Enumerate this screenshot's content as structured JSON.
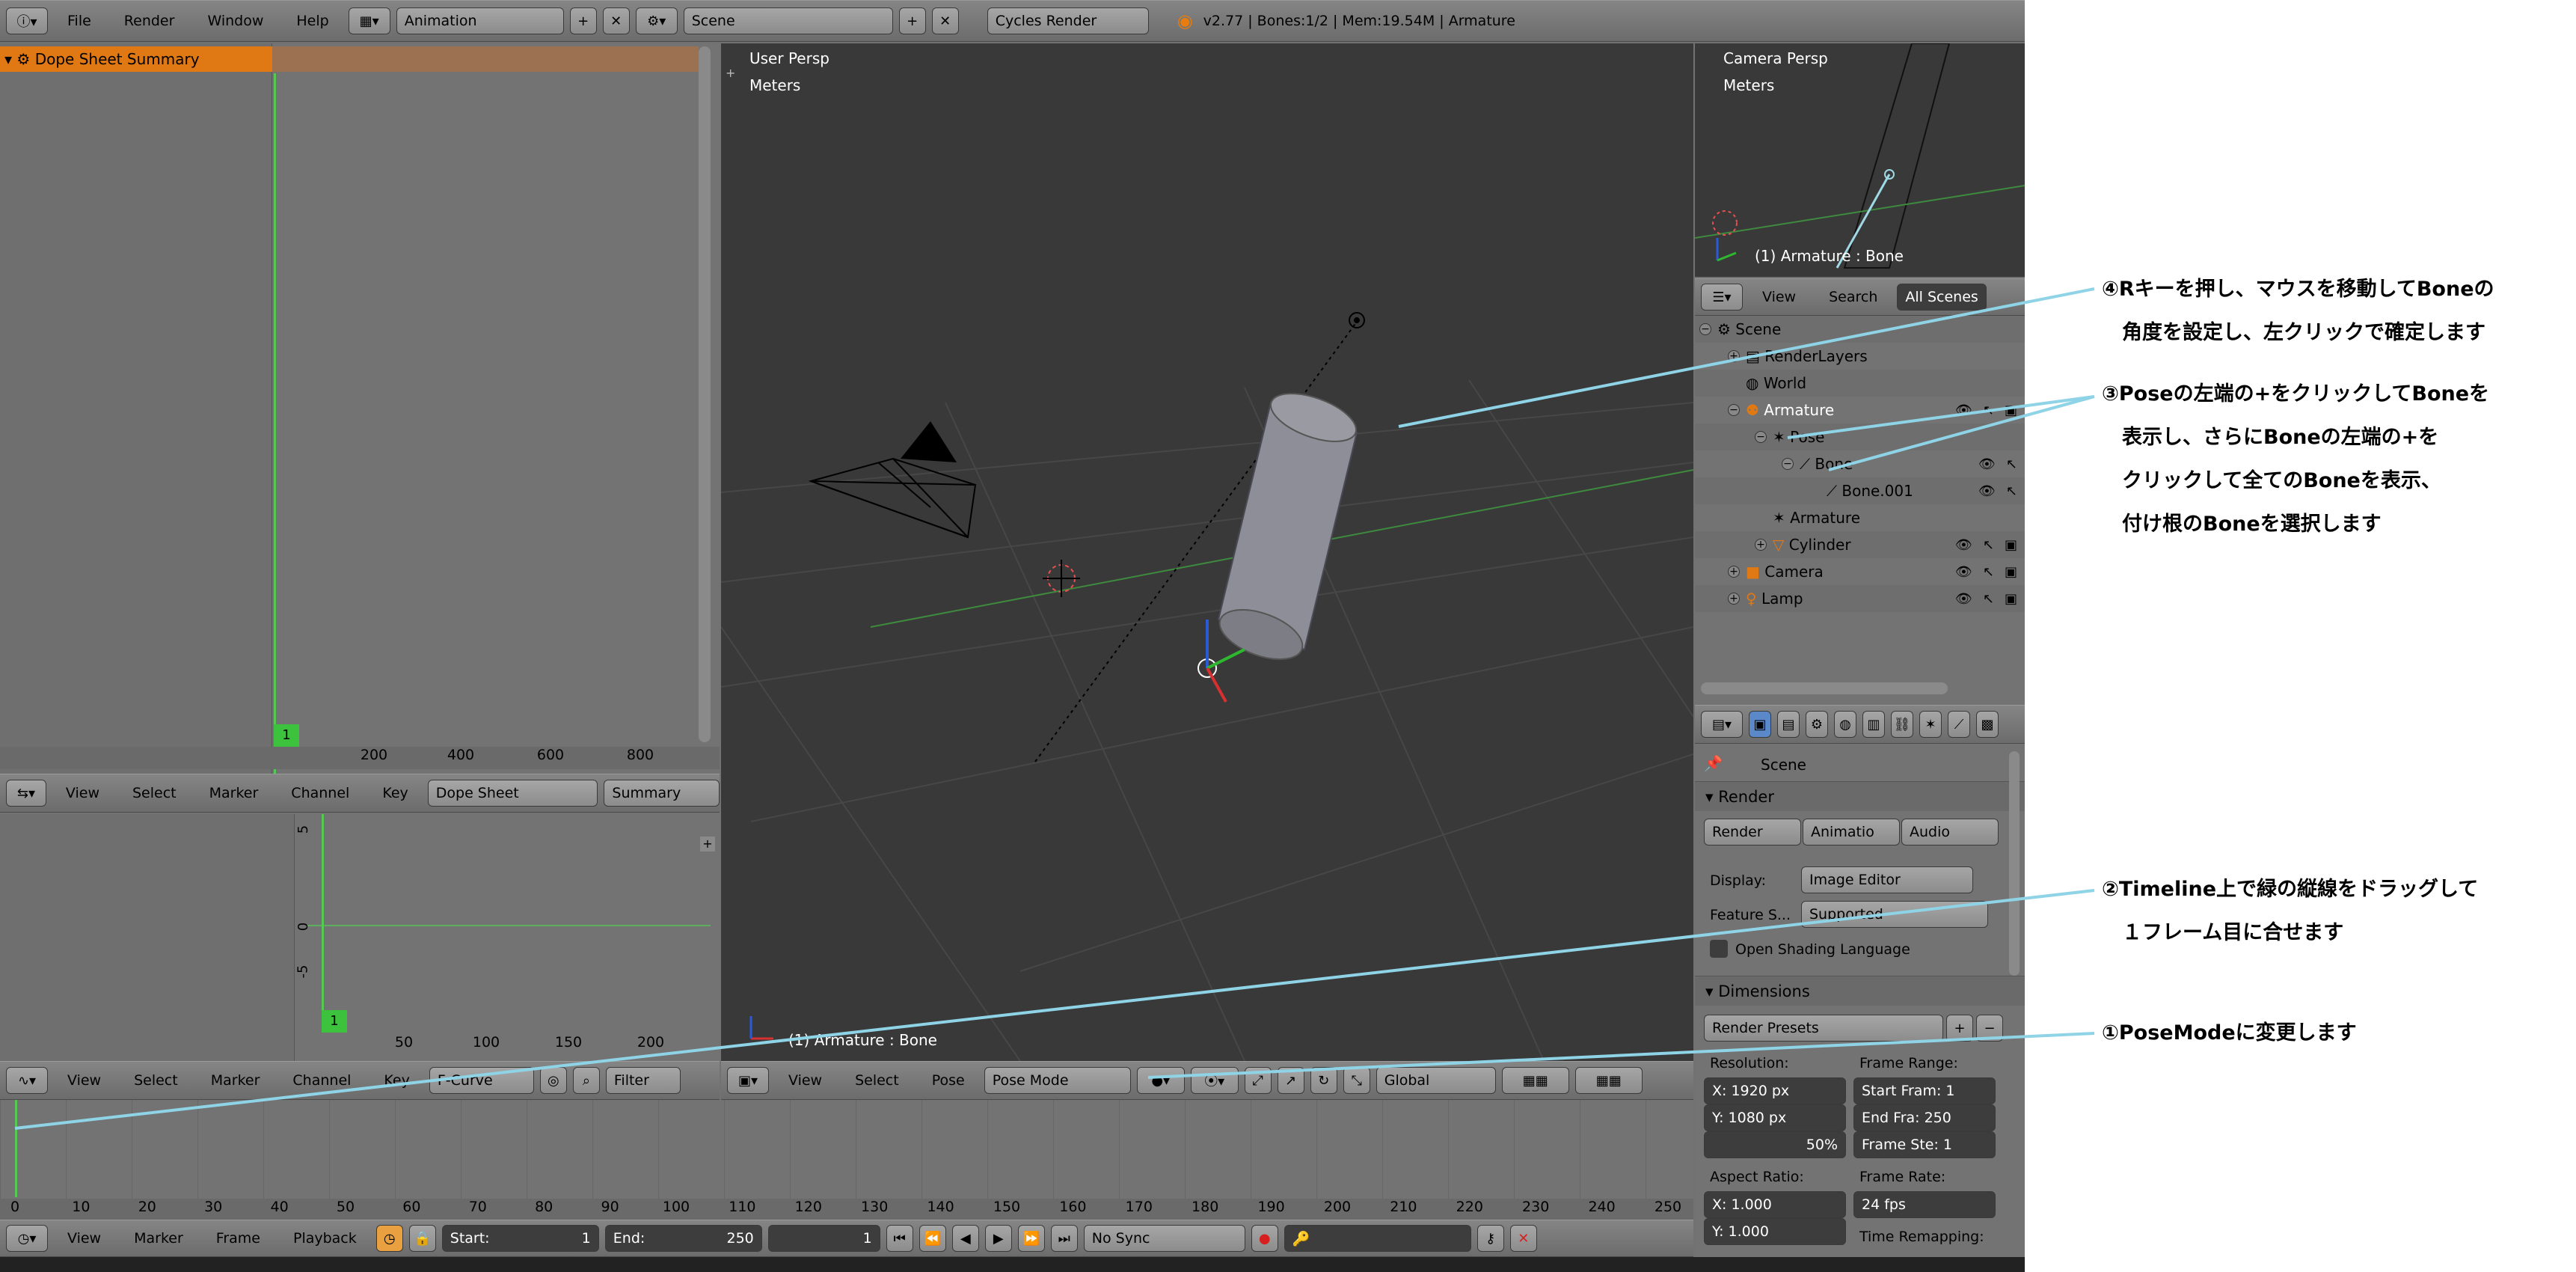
{
  "info_header": {
    "menus": [
      "File",
      "Render",
      "Window",
      "Help"
    ],
    "screen_layout": "Animation",
    "scene": "Scene",
    "engine": "Cycles Render",
    "status": "v2.77 | Bones:1/2  | Mem:19.54M | Armature"
  },
  "dopesheet": {
    "channel_summary": "Dope Sheet Summary",
    "ruler": [
      "200",
      "400",
      "600",
      "800"
    ],
    "current_frame": "1",
    "header_menus": [
      "View",
      "Select",
      "Marker",
      "Channel",
      "Key"
    ],
    "mode": "Dope Sheet",
    "summary_button": "Summary"
  },
  "graph_editor": {
    "y_ticks": [
      "5",
      "0",
      "-5"
    ],
    "ruler": [
      "50",
      "100",
      "150",
      "200"
    ],
    "current_frame": "1",
    "header_menus": [
      "View",
      "Select",
      "Marker",
      "Channel",
      "Key"
    ],
    "mode": "F-Curve",
    "filter": "Filter"
  },
  "viewport": {
    "view_name": "User Persp",
    "units": "Meters",
    "object_info": "(1) Armature : Bone",
    "header_menus": [
      "View",
      "Select",
      "Pose"
    ],
    "mode": "Pose Mode",
    "orientation": "Global"
  },
  "camera_view": {
    "view_name": "Camera Persp",
    "units": "Meters",
    "object_info": "(1) Armature : Bone"
  },
  "outliner": {
    "header_menus": [
      "View",
      "Search"
    ],
    "filter": "All Scenes",
    "items": [
      "Scene",
      "RenderLayers",
      "World",
      "Armature",
      "Pose",
      "Bone",
      "Bone.001",
      "Armature",
      "Cylinder",
      "Camera",
      "Lamp"
    ]
  },
  "properties": {
    "context": "Scene",
    "render_panel": "Render",
    "render_buttons": [
      "Render",
      "Animatio",
      "Audio"
    ],
    "display_label": "Display:",
    "display_value": "Image Editor",
    "feature_label": "Feature S...",
    "feature_value": "Supported",
    "osl_label": "Open Shading Language",
    "dimensions_panel": "Dimensions",
    "render_presets": "Render Presets",
    "resolution_label": "Resolution:",
    "res_x": "X:   1920 px",
    "res_y": "Y:   1080 px",
    "res_pct": "50%",
    "frame_range_label": "Frame Range:",
    "start_frame": "Start Fram: 1",
    "end_frame": "End Fra:  250",
    "frame_step": "Frame Ste:  1",
    "aspect_label": "Aspect Ratio:",
    "asp_x": "X:     1.000",
    "asp_y": "Y:     1.000",
    "frame_rate_label": "Frame Rate:",
    "fps": "24 fps",
    "time_remap": "Time Remapping:"
  },
  "timeline": {
    "ruler": [
      "0",
      "10",
      "20",
      "30",
      "40",
      "50",
      "60",
      "70",
      "80",
      "90",
      "100",
      "110",
      "120",
      "130",
      "140",
      "150",
      "160",
      "170",
      "180",
      "190",
      "200",
      "210",
      "220",
      "230",
      "240",
      "250"
    ],
    "header_menus": [
      "View",
      "Marker",
      "Frame",
      "Playback"
    ],
    "start": "Start:",
    "start_value": "1",
    "end": "End:",
    "end_value": "250",
    "current": "1",
    "sync": "No Sync"
  },
  "annotations": [
    {
      "lines": [
        "④Rキーを押し、マウスを移動してBoneの",
        "　角度を設定し、左クリックで確定します"
      ]
    },
    {
      "lines": [
        "③Poseの左端の+をクリックしてBoneを",
        "　表示し、さらにBoneの左端の+を",
        "　クリックして全てのBoneを表示、",
        "　付け根のBoneを選択します"
      ]
    },
    {
      "lines": [
        "②Timeline上で緑の縦線をドラッグして",
        "　１フレーム目に合せます"
      ]
    },
    {
      "lines": [
        "①PoseModeに変更します"
      ]
    }
  ],
  "colors": {
    "accent": "#e07914",
    "annotation_line": "#8fd3e6",
    "frame_line": "#55c855"
  }
}
